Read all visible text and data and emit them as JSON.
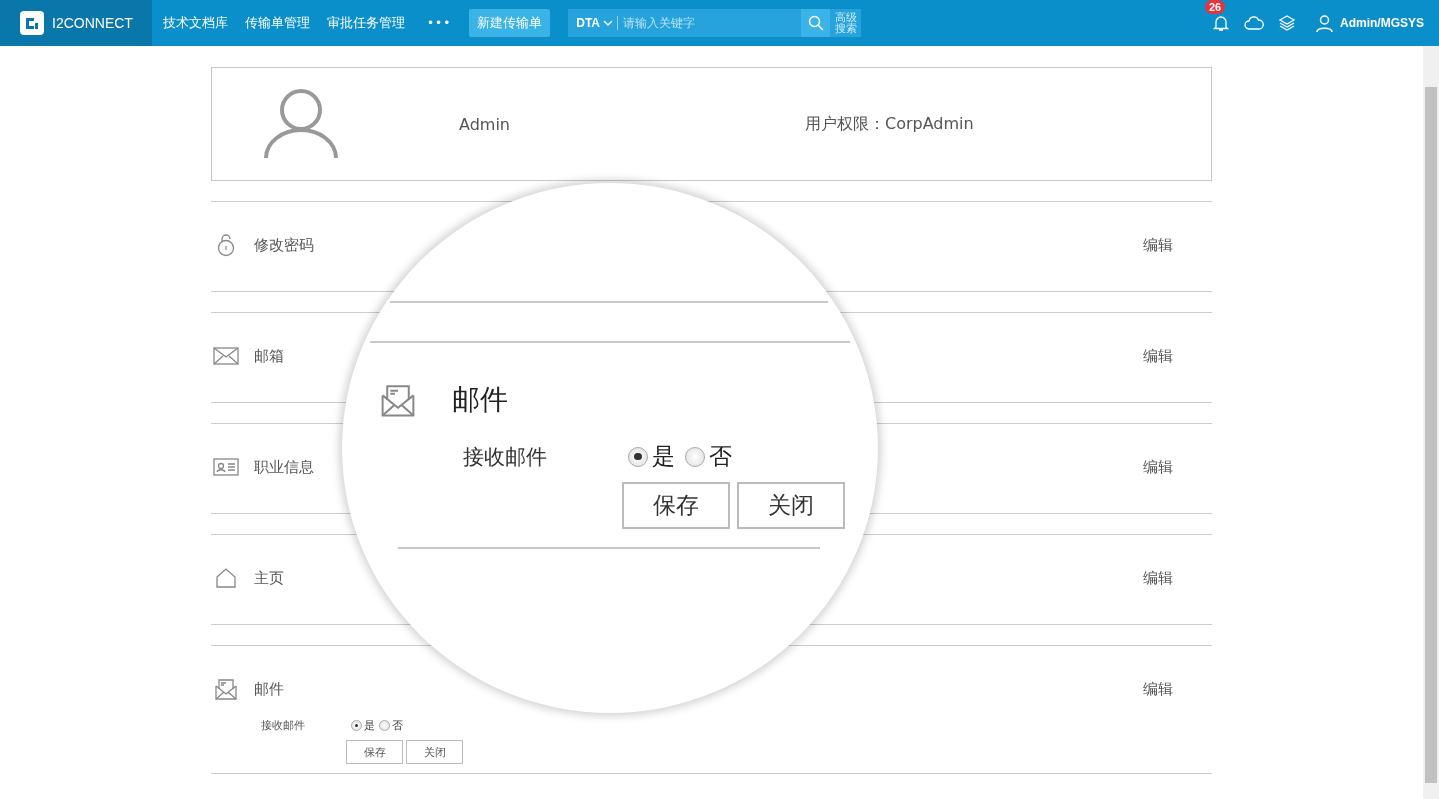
{
  "nav": {
    "logo": "I2CONNECT",
    "items": [
      {
        "label": "技术文档库"
      },
      {
        "label": "传输单管理"
      },
      {
        "label": "审批任务管理"
      }
    ],
    "more": "•••",
    "new_button": "新建传输单",
    "scope": "DTA",
    "search": {
      "placeholder": "请输入关键字"
    },
    "advanced": "高级搜索",
    "notifications": "26",
    "user": "Admin/MGSYS"
  },
  "profile": {
    "name": "Admin",
    "permission": "用户权限：CorpAdmin"
  },
  "sections": [
    {
      "kind": "lock",
      "title": "修改密码",
      "action": "编辑"
    },
    {
      "kind": "envelope",
      "title": "邮箱",
      "action": "编辑"
    },
    {
      "kind": "id-card",
      "title": "职业信息",
      "action": "编辑"
    },
    {
      "kind": "house",
      "title": "主页",
      "action": "编辑"
    },
    {
      "kind": "mail",
      "title": "邮件",
      "action": "编辑",
      "field": {
        "label": "接收邮件",
        "options": [
          {
            "label": "是",
            "selected": true
          },
          {
            "label": "否",
            "selected": false
          }
        ]
      },
      "buttons": [
        "保存",
        "关闭"
      ]
    }
  ],
  "magnifier": {
    "title": "邮件",
    "field": {
      "label": "接收邮件",
      "options": [
        {
          "label": "是",
          "selected": true
        },
        {
          "label": "否",
          "selected": false
        }
      ]
    },
    "buttons": [
      "保存",
      "关闭"
    ]
  }
}
